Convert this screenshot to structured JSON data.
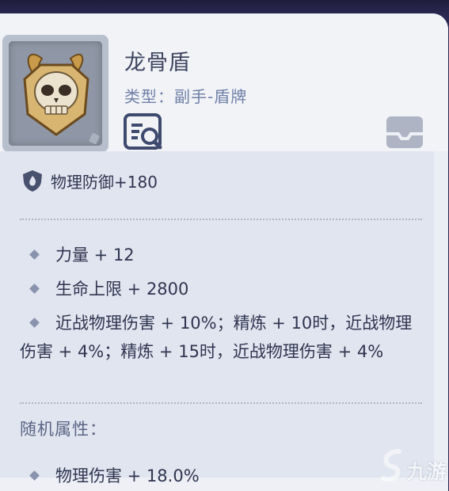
{
  "item": {
    "name": "龙骨盾",
    "type": "类型：副手-盾牌"
  },
  "icons": {
    "portrait": "dragon-skull-shield-image",
    "inspect": "inspect-magnifier-icon",
    "box": "tray-box-icon",
    "defense": "shield-flame-icon",
    "watermark": "jiuyou-logo"
  },
  "stats": {
    "base": "物理防御+180",
    "lines": [
      "力量 + 12",
      "生命上限 + 2800"
    ],
    "refine_text": "近战物理伤害 + 10%；精炼 + 10时，近战物理伤害 + 4%；精炼 + 15时，近战物理伤害 + 4%"
  },
  "random": {
    "title": "随机属性：",
    "lines": [
      "物理伤害 + 18.0%"
    ]
  },
  "watermark": {
    "text": "九游"
  }
}
